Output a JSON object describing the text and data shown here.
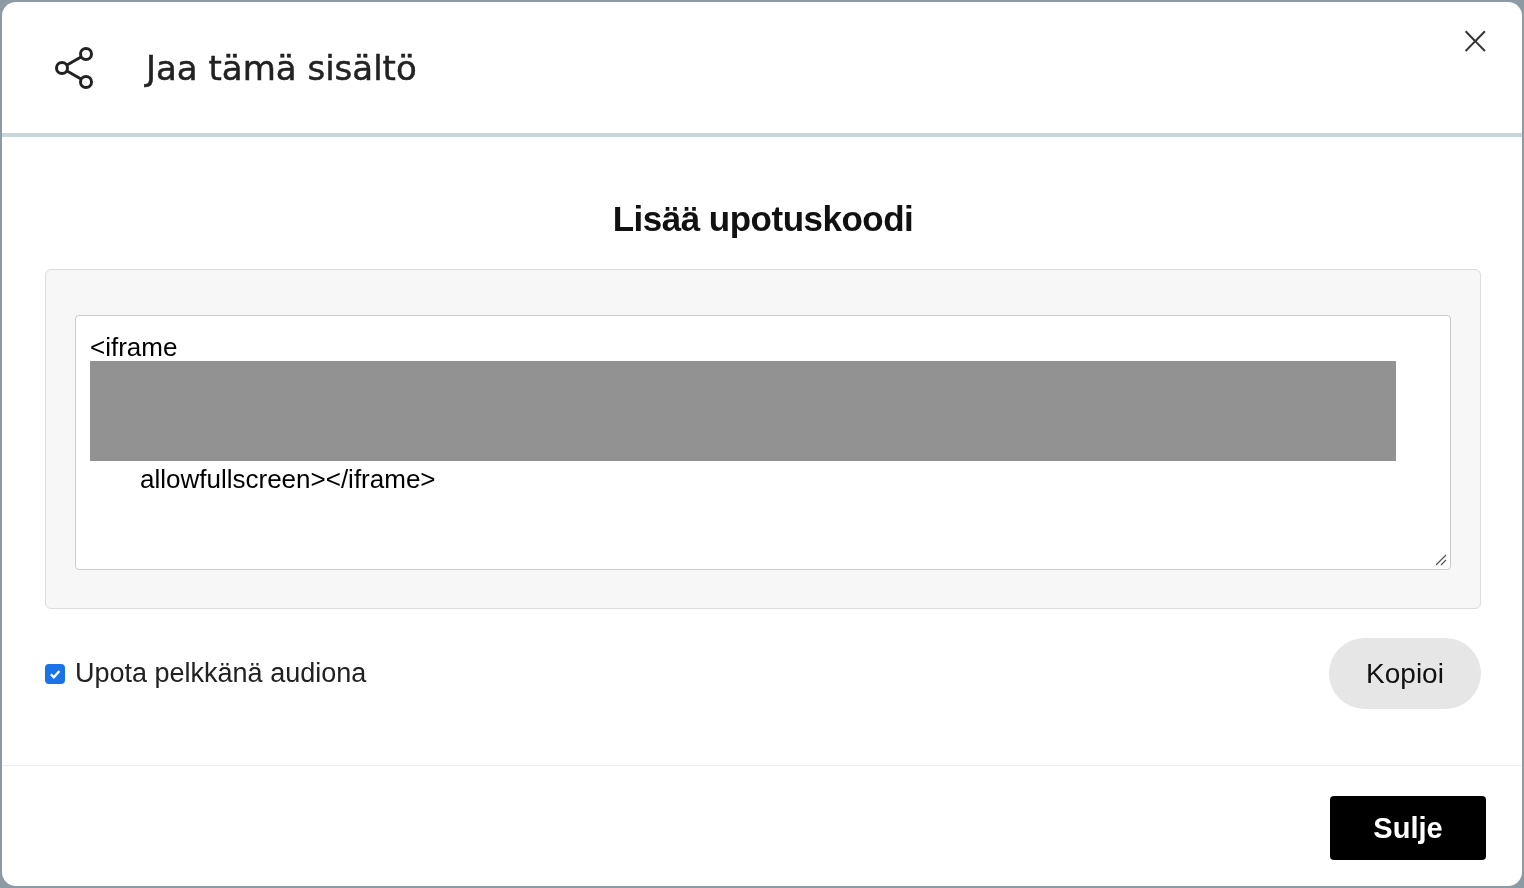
{
  "dialog": {
    "title": "Jaa tämä sisältö",
    "close": "×"
  },
  "embed": {
    "heading": "Lisää upotuskoodi",
    "code_lines": [
      {
        "text": "<iframe",
        "indent": false,
        "redacted_after": true
      },
      {
        "text": "allowfullscreen></iframe>",
        "indent": true,
        "redacted_after": false
      }
    ]
  },
  "audio_only": {
    "label": "Upota pelkkänä audiona",
    "checked": true
  },
  "copy_button": "Kopioi",
  "close_button": "Sulje"
}
